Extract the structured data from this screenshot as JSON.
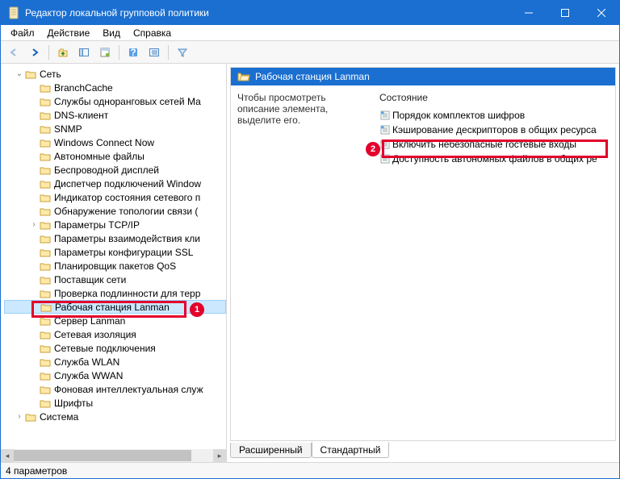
{
  "title": "Редактор локальной групповой политики",
  "menu": {
    "file": "Файл",
    "action": "Действие",
    "view": "Вид",
    "help": "Справка"
  },
  "tree": {
    "root": "Сеть",
    "items": [
      "BranchCache",
      "Службы одноранговых сетей Ма",
      "DNS-клиент",
      "SNMP",
      "Windows Connect Now",
      "Автономные файлы",
      "Беспроводной дисплей",
      "Диспетчер подключений Window",
      "Индикатор состояния сетевого п",
      "Обнаружение топологии связи (",
      "Параметры TCP/IP",
      "Параметры взаимодействия кли",
      "Параметры конфигурации SSL",
      "Планировщик пакетов QoS",
      "Поставщик сети",
      "Проверка подлинности для терр",
      "Рабочая станция Lanman",
      "Сервер Lanman",
      "Сетевая изоляция",
      "Сетевые подключения",
      "Служба WLAN",
      "Служба WWAN",
      "Фоновая интеллектуальная служ",
      "Шрифты"
    ],
    "next": "Система"
  },
  "right": {
    "header": "Рабочая станция Lanman",
    "desc": "Чтобы просмотреть описание элемента, выделите его.",
    "col": "Состояние",
    "policies": [
      "Порядок комплектов шифров",
      "Кэширование дескрипторов в общих ресурса",
      "Включить небезопасные гостевые входы",
      "Доступность автономных файлов в общих ре"
    ]
  },
  "tabs": {
    "ext": "Расширенный",
    "std": "Стандартный"
  },
  "status": "4 параметров",
  "badges": {
    "one": "1",
    "two": "2"
  }
}
